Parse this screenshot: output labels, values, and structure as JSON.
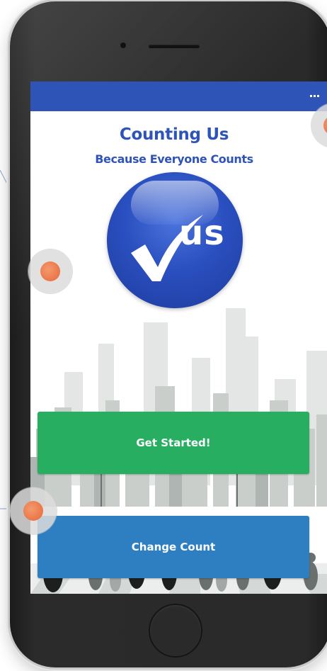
{
  "app": {
    "title": "Counting Us",
    "tagline": "Because Everyone Counts",
    "logo_text": "us"
  },
  "topbar": {
    "menu_icon": "ellipsis-menu-icon"
  },
  "buttons": {
    "get_started": "Get Started!",
    "change_count": "Change Count"
  },
  "colors": {
    "topbar": "#2f54b8",
    "title": "#2f54b8",
    "get_started": "#27ae60",
    "change_count": "#2e7fc2",
    "hotspot": "#e8663a"
  }
}
